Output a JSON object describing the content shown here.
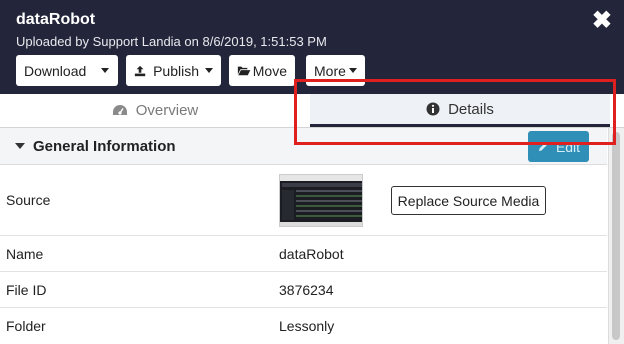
{
  "header": {
    "title": "dataRobot",
    "subtitle": "Uploaded by Support Landia on 8/6/2019, 1:51:53 PM",
    "close_label": "✖"
  },
  "toolbar": {
    "download_label": "Download",
    "publish_label": "Publish",
    "move_label": "Move",
    "more_label": "More"
  },
  "tabs": {
    "overview_label": "Overview",
    "details_label": "Details"
  },
  "section": {
    "title": "General Information",
    "edit_label": "Edit"
  },
  "rows": {
    "source_label": "Source",
    "replace_label": "Replace Source Media",
    "name_label": "Name",
    "name_value": "dataRobot",
    "fileid_label": "File ID",
    "fileid_value": "3876234",
    "folder_label": "Folder",
    "folder_value": "Lessonly"
  },
  "colors": {
    "header_bg": "#23263a",
    "edit_button": "#2f8fb6",
    "highlight": "#e01f1f"
  }
}
